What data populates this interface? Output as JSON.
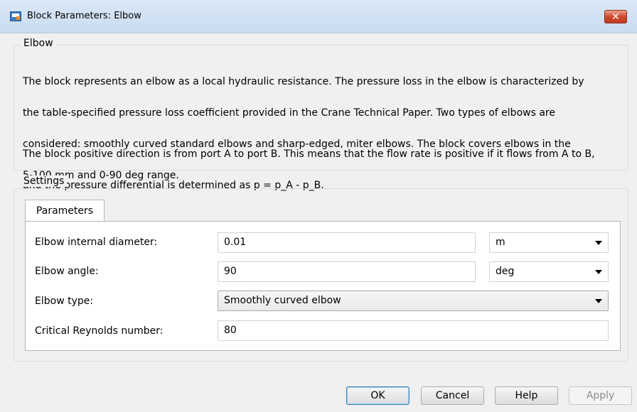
{
  "window": {
    "title": "Block Parameters: Elbow",
    "close_glyph": "✕"
  },
  "elbow_group": {
    "label": "Elbow",
    "paragraph1_lines": [
      "The block represents an elbow as a local hydraulic resistance. The pressure loss in the elbow is characterized by",
      "the table-specified pressure loss coefficient provided in the Crane Technical Paper. Two types of elbows are",
      "considered: smoothly curved standard elbows and sharp-edged, miter elbows. The block covers elbows in the",
      "5-100 mm and 0-90 deg range."
    ],
    "paragraph2_lines": [
      "The block positive direction is from port A to port B. This means that the flow rate is positive if it flows from A to B,",
      "and the pressure differential is determined as p = p_A - p_B."
    ]
  },
  "settings": {
    "label": "Settings",
    "tabs": [
      {
        "label": "Parameters"
      }
    ],
    "params": [
      {
        "label": "Elbow internal diameter:",
        "value": "0.01",
        "unit": "m"
      },
      {
        "label": "Elbow angle:",
        "value": "90",
        "unit": "deg"
      },
      {
        "label": "Elbow type:",
        "value": "Smoothly curved elbow"
      },
      {
        "label": "Critical Reynolds number:",
        "value": "80"
      }
    ]
  },
  "buttons": {
    "ok": "OK",
    "cancel": "Cancel",
    "help": "Help",
    "apply": "Apply"
  },
  "icons": {
    "app": "simulink-block-icon",
    "close": "close-icon",
    "dropdown": "chevron-down-icon"
  },
  "colors": {
    "titlebar": "#d2e2f4",
    "close_button": "#cf4a30",
    "default_button_border": "#3c7fb1"
  }
}
